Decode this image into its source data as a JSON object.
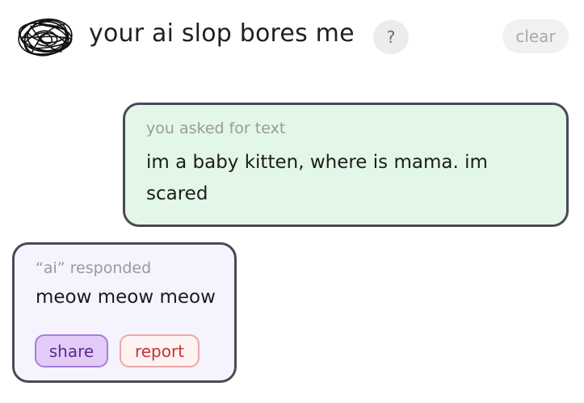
{
  "header": {
    "title": "your ai slop bores me",
    "help_label": "?",
    "clear_label": "clear",
    "logo_icon": "scribble-logo-icon"
  },
  "prompt": {
    "label": "you asked for text",
    "text": "im a baby kitten, where is mama. im scared"
  },
  "response": {
    "label": "“ai” responded",
    "text": "meow meow meow",
    "share_label": "share",
    "report_label": "report"
  },
  "colors": {
    "prompt_bg": "#e3f7e8",
    "response_bg": "#f5f3fd",
    "border": "#4a4a55",
    "share_bg": "#e2ccf7",
    "share_text": "#5a2a8f",
    "report_text": "#c23232"
  }
}
